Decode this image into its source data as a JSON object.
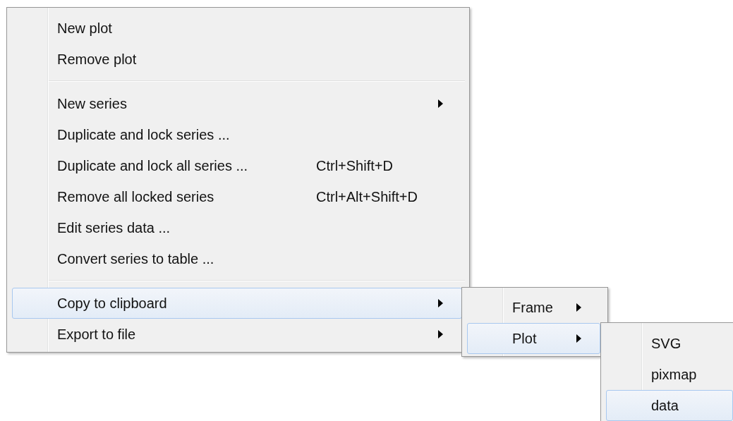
{
  "menu": {
    "items": [
      {
        "kind": "item",
        "label": "New plot",
        "selected": false
      },
      {
        "kind": "item",
        "label": "Remove plot",
        "selected": false
      },
      {
        "kind": "separator"
      },
      {
        "kind": "item",
        "label": "New series",
        "has_submenu": true,
        "selected": false
      },
      {
        "kind": "item",
        "label": "Duplicate and lock series ...",
        "selected": false
      },
      {
        "kind": "item",
        "label": "Duplicate and lock all series ...",
        "shortcut": "Ctrl+Shift+D",
        "selected": false
      },
      {
        "kind": "item",
        "label": "Remove all locked series",
        "shortcut": "Ctrl+Alt+Shift+D",
        "selected": false
      },
      {
        "kind": "item",
        "label": "Edit series data ...",
        "selected": false
      },
      {
        "kind": "item",
        "label": "Convert series to table ...",
        "selected": false
      },
      {
        "kind": "separator"
      },
      {
        "kind": "item",
        "label": "Copy to clipboard",
        "has_submenu": true,
        "selected": true,
        "submenu": {
          "items": [
            {
              "kind": "item",
              "label": "Frame",
              "has_submenu": true,
              "selected": false
            },
            {
              "kind": "item",
              "label": "Plot",
              "has_submenu": true,
              "selected": true,
              "submenu": {
                "items": [
                  {
                    "kind": "item",
                    "label": "SVG",
                    "selected": false
                  },
                  {
                    "kind": "item",
                    "label": "pixmap",
                    "selected": false
                  },
                  {
                    "kind": "item",
                    "label": "data",
                    "selected": true
                  }
                ]
              }
            }
          ]
        }
      },
      {
        "kind": "item",
        "label": "Export to file",
        "has_submenu": true,
        "selected": false
      }
    ]
  }
}
